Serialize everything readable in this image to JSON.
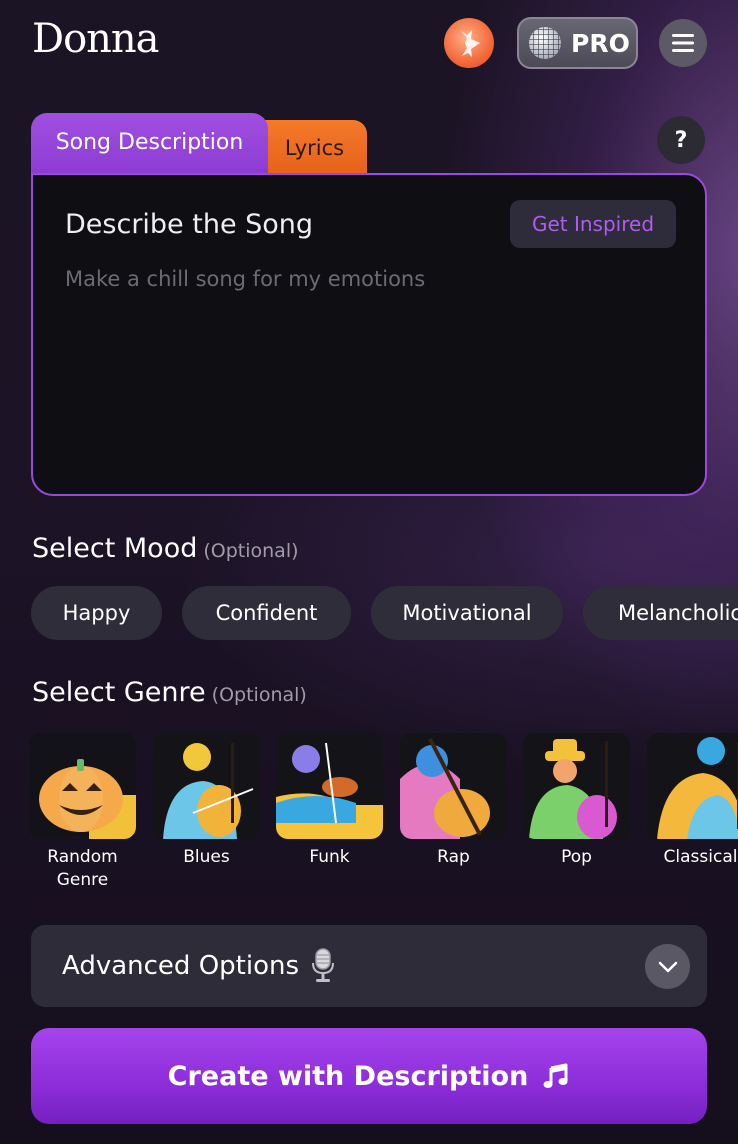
{
  "header": {
    "logo": "Donna",
    "pro_label": "PRO"
  },
  "tabs": [
    {
      "label": "Song Description",
      "active": true
    },
    {
      "label": "Lyrics",
      "active": false
    }
  ],
  "help_label": "?",
  "description": {
    "title": "Describe the Song",
    "inspire_label": "Get Inspired",
    "placeholder": "Make a chill song for my emotions",
    "value": ""
  },
  "mood": {
    "title": "Select Mood",
    "optional": "(Optional)",
    "options": [
      "Happy",
      "Confident",
      "Motivational",
      "Melancholic"
    ]
  },
  "genre": {
    "title": "Select Genre",
    "optional": "(Optional)",
    "options": [
      "Random\nGenre",
      "Blues",
      "Funk",
      "Rap",
      "Pop",
      "Classical"
    ]
  },
  "advanced": {
    "label": "Advanced Options",
    "icon": "microphone-icon",
    "expanded": false
  },
  "create_button": {
    "label": "Create with Description",
    "icon": "music-note-icon"
  },
  "colors": {
    "accent_purple": "#9d47e0",
    "lyrics_orange": "#f0701f",
    "background": "#1b1424"
  }
}
